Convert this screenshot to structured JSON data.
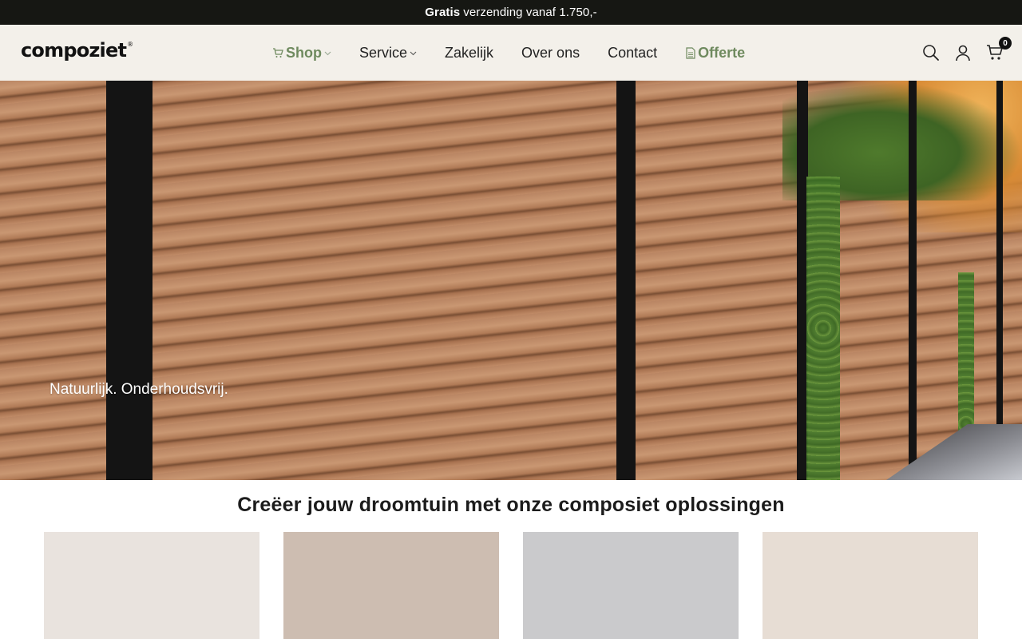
{
  "announcement": {
    "bold": "Gratis",
    "text": "verzending vanaf 1.750,-"
  },
  "header": {
    "logo": "compoziet",
    "logo_mark": "®",
    "nav": {
      "shop": "Shop",
      "service": "Service",
      "zakelijk": "Zakelijk",
      "over_ons": "Over ons",
      "contact": "Contact",
      "offerte": "Offerte"
    },
    "cart_count": "0",
    "icons": [
      "search-icon",
      "account-icon",
      "cart-icon"
    ]
  },
  "hero": {
    "tagline": "Natuurlijk. Onderhoudsvrij."
  },
  "section": {
    "title": "Creëer jouw droomtuin met onze composiet oplossingen"
  },
  "cards": [
    {
      "color": "#e9e3de"
    },
    {
      "color": "#cdbdb1"
    },
    {
      "color": "#cacacc"
    },
    {
      "color": "#e7ddd4"
    }
  ],
  "colors": {
    "accent": "#6f8a5f",
    "announce_bg": "#161713",
    "header_bg": "#f3f0ea"
  }
}
